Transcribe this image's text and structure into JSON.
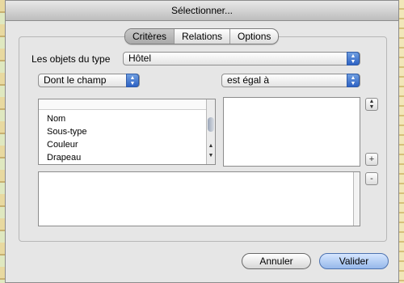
{
  "window": {
    "title": "Sélectionner..."
  },
  "tabs": [
    {
      "label": "Critères",
      "active": true
    },
    {
      "label": "Relations",
      "active": false
    },
    {
      "label": "Options",
      "active": false
    }
  ],
  "criteria": {
    "object_type_label": "Les objets du type",
    "object_type_value": "Hôtel",
    "field_popup_value": "Dont le champ",
    "operator_popup_value": "est égal à",
    "fields_list": [
      "Nom",
      "Sous-type",
      "Couleur",
      "Drapeau"
    ]
  },
  "buttons": {
    "add": "+",
    "remove": "-",
    "cancel": "Annuler",
    "ok": "Valider"
  },
  "icons": {
    "popup_arrows": "updown-arrows-icon",
    "stepper": "stepper-icon"
  },
  "colors": {
    "window_bg": "#e6e6e6",
    "accent": "#2d62c4"
  }
}
